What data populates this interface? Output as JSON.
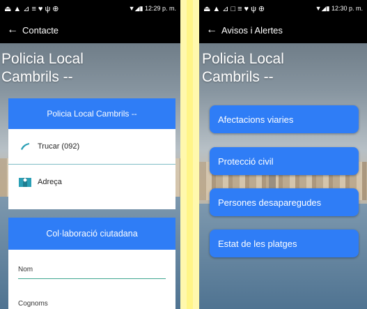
{
  "left": {
    "status": {
      "icons": "⏏▲⊿≡♥ψ⊕",
      "time": "12:29 p. m."
    },
    "appbar": {
      "title": "Contacte"
    },
    "title_line1": "Policia Local",
    "title_line2": "Cambrils --",
    "card_header": "Policia Local Cambrils --",
    "contacts": [
      {
        "label": "Trucar (092)",
        "icon": "phone-icon"
      },
      {
        "label": "Adreça",
        "icon": "map-icon"
      }
    ],
    "collab_header": "Col·laboració ciutadana",
    "fields": [
      "Nom",
      "Cognoms"
    ]
  },
  "right": {
    "status": {
      "icons": "⏏▲⊿□≡♥ψ⊕",
      "time": "12:30 p. m."
    },
    "appbar": {
      "title": "Avisos i Alertes"
    },
    "title_line1": "Policia Local",
    "title_line2": "Cambrils --",
    "buttons": [
      "Afectacions viaries",
      "Protecció civil",
      "Persones desaparegudes",
      "Estat de les platges"
    ]
  },
  "colors": {
    "accent": "#2f7df6",
    "appbar": "#000000",
    "stripe": "#fff36a"
  }
}
